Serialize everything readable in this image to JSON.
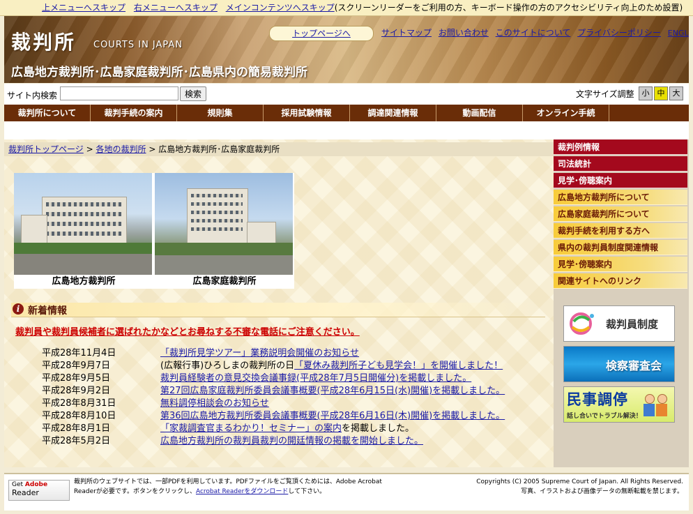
{
  "skip": {
    "links": [
      "上メニューへスキップ",
      "右メニューへスキップ",
      "メインコンテンツへスキップ"
    ],
    "note": "(スクリーンリーダーをご利用の方、キーボード操作の方のアクセシビリティ向上のため設置)"
  },
  "header": {
    "logo": "裁判所",
    "logo_en": "COURTS IN JAPAN",
    "court_title": "広島地方裁判所･広島家庭裁判所･広島県内の簡易裁判所",
    "top_link": "トップページへ",
    "nav": [
      "サイトマップ",
      "お問い合わせ",
      "このサイトについて",
      "プライバシーポリシー",
      "ENGLISH"
    ]
  },
  "search": {
    "label": "サイト内検索",
    "value": "",
    "button": "検索",
    "fontsize_label": "文字サイズ調整",
    "sizes": [
      "小",
      "中",
      "大"
    ]
  },
  "mainnav": [
    "裁判所について",
    "裁判手続の案内",
    "規則集",
    "採用試験情報",
    "調達関連情報",
    "動画配信",
    "オンライン手続"
  ],
  "breadcrumb": {
    "items": [
      "裁判所トップページ",
      "各地の裁判所"
    ],
    "current": "広島地方裁判所･広島家庭裁判所",
    "sep": ">"
  },
  "photos": {
    "caption1": "広島地方裁判所",
    "caption2": "広島家庭裁判所"
  },
  "news": {
    "title": "新着情報",
    "alert": "裁判員や裁判員候補者に選ばれたかなどとお尋ねする不審な電話にご注意ください。",
    "items": [
      {
        "date": "平成28年11月4日",
        "pre": "",
        "link": "「裁判所見学ツアー」業務説明会開催のお知らせ",
        "post": ""
      },
      {
        "date": "平成28年9月7日",
        "pre": "(広報行事)ひろしまの裁判所の日",
        "link": "「夏休み裁判所子ども見学会！」を開催しました！",
        "post": ""
      },
      {
        "date": "平成28年9月5日",
        "pre": "",
        "link": "裁判員経験者の意見交換会議事録(平成28年7月5日開催分)を掲載しました。",
        "post": ""
      },
      {
        "date": "平成28年9月2日",
        "pre": "",
        "link": "第27回広島家庭裁判所委員会議事概要(平成28年6月15日(水)開催)を掲載しました。",
        "post": ""
      },
      {
        "date": "平成28年8月31日",
        "pre": "",
        "link": "無料調停相談会のお知らせ",
        "post": ""
      },
      {
        "date": "平成28年8月10日",
        "pre": "",
        "link": "第36回広島地方裁判所委員会議事概要(平成28年6月16日(木)開催)を掲載しました。",
        "post": ""
      },
      {
        "date": "平成28年8月1日",
        "pre": "",
        "link": "「家裁調査官まるわかり！セミナー」の案内",
        "post": "を掲載しました。"
      },
      {
        "date": "平成28年5月2日",
        "pre": "",
        "link": "広島地方裁判所の裁判員裁判の開廷情報の掲載を開始しました。",
        "post": ""
      }
    ]
  },
  "sidebar": {
    "red": [
      "裁判例情報",
      "司法統計",
      "見学･傍聴案内"
    ],
    "yellow": [
      "広島地方裁判所について",
      "広島家庭裁判所について",
      "裁判手続を利用する方へ",
      "県内の裁判員制度関連情報",
      "見学･傍聴案内",
      "関連サイトへのリンク"
    ],
    "banners": {
      "saibanin": "裁判員制度",
      "kensatsu": "検察審査会",
      "minji_title": "民事調停",
      "minji_sub": "話し合いでトラブル解決！"
    }
  },
  "footer": {
    "adobe_get": "Get",
    "adobe_brand": "Adobe",
    "adobe_reader": "Reader",
    "text1": "裁判所のウェブサイトでは、一部PDFを利用しています。PDFファイルをご覧頂くためには、Adobe Acrobat",
    "text2_pre": "Readerが必要です。ボタンをクリックし、",
    "text2_link": "Acrobat Readerをダウンロード",
    "text2_post": "して下さい。",
    "copyright1": "Copyrights (C) 2005 Supreme Court of Japan. All Rights Reserved.",
    "copyright2": "写真、イラストおよび画像データの無断転載を禁じます。"
  },
  "colors": {
    "nav_bg": "#6a2d08",
    "sidebar_red": "#a4091d",
    "sidebar_yellow": "#f8cc3a",
    "alert_red": "#cc0000",
    "link_blue": "#1a1aa6"
  }
}
